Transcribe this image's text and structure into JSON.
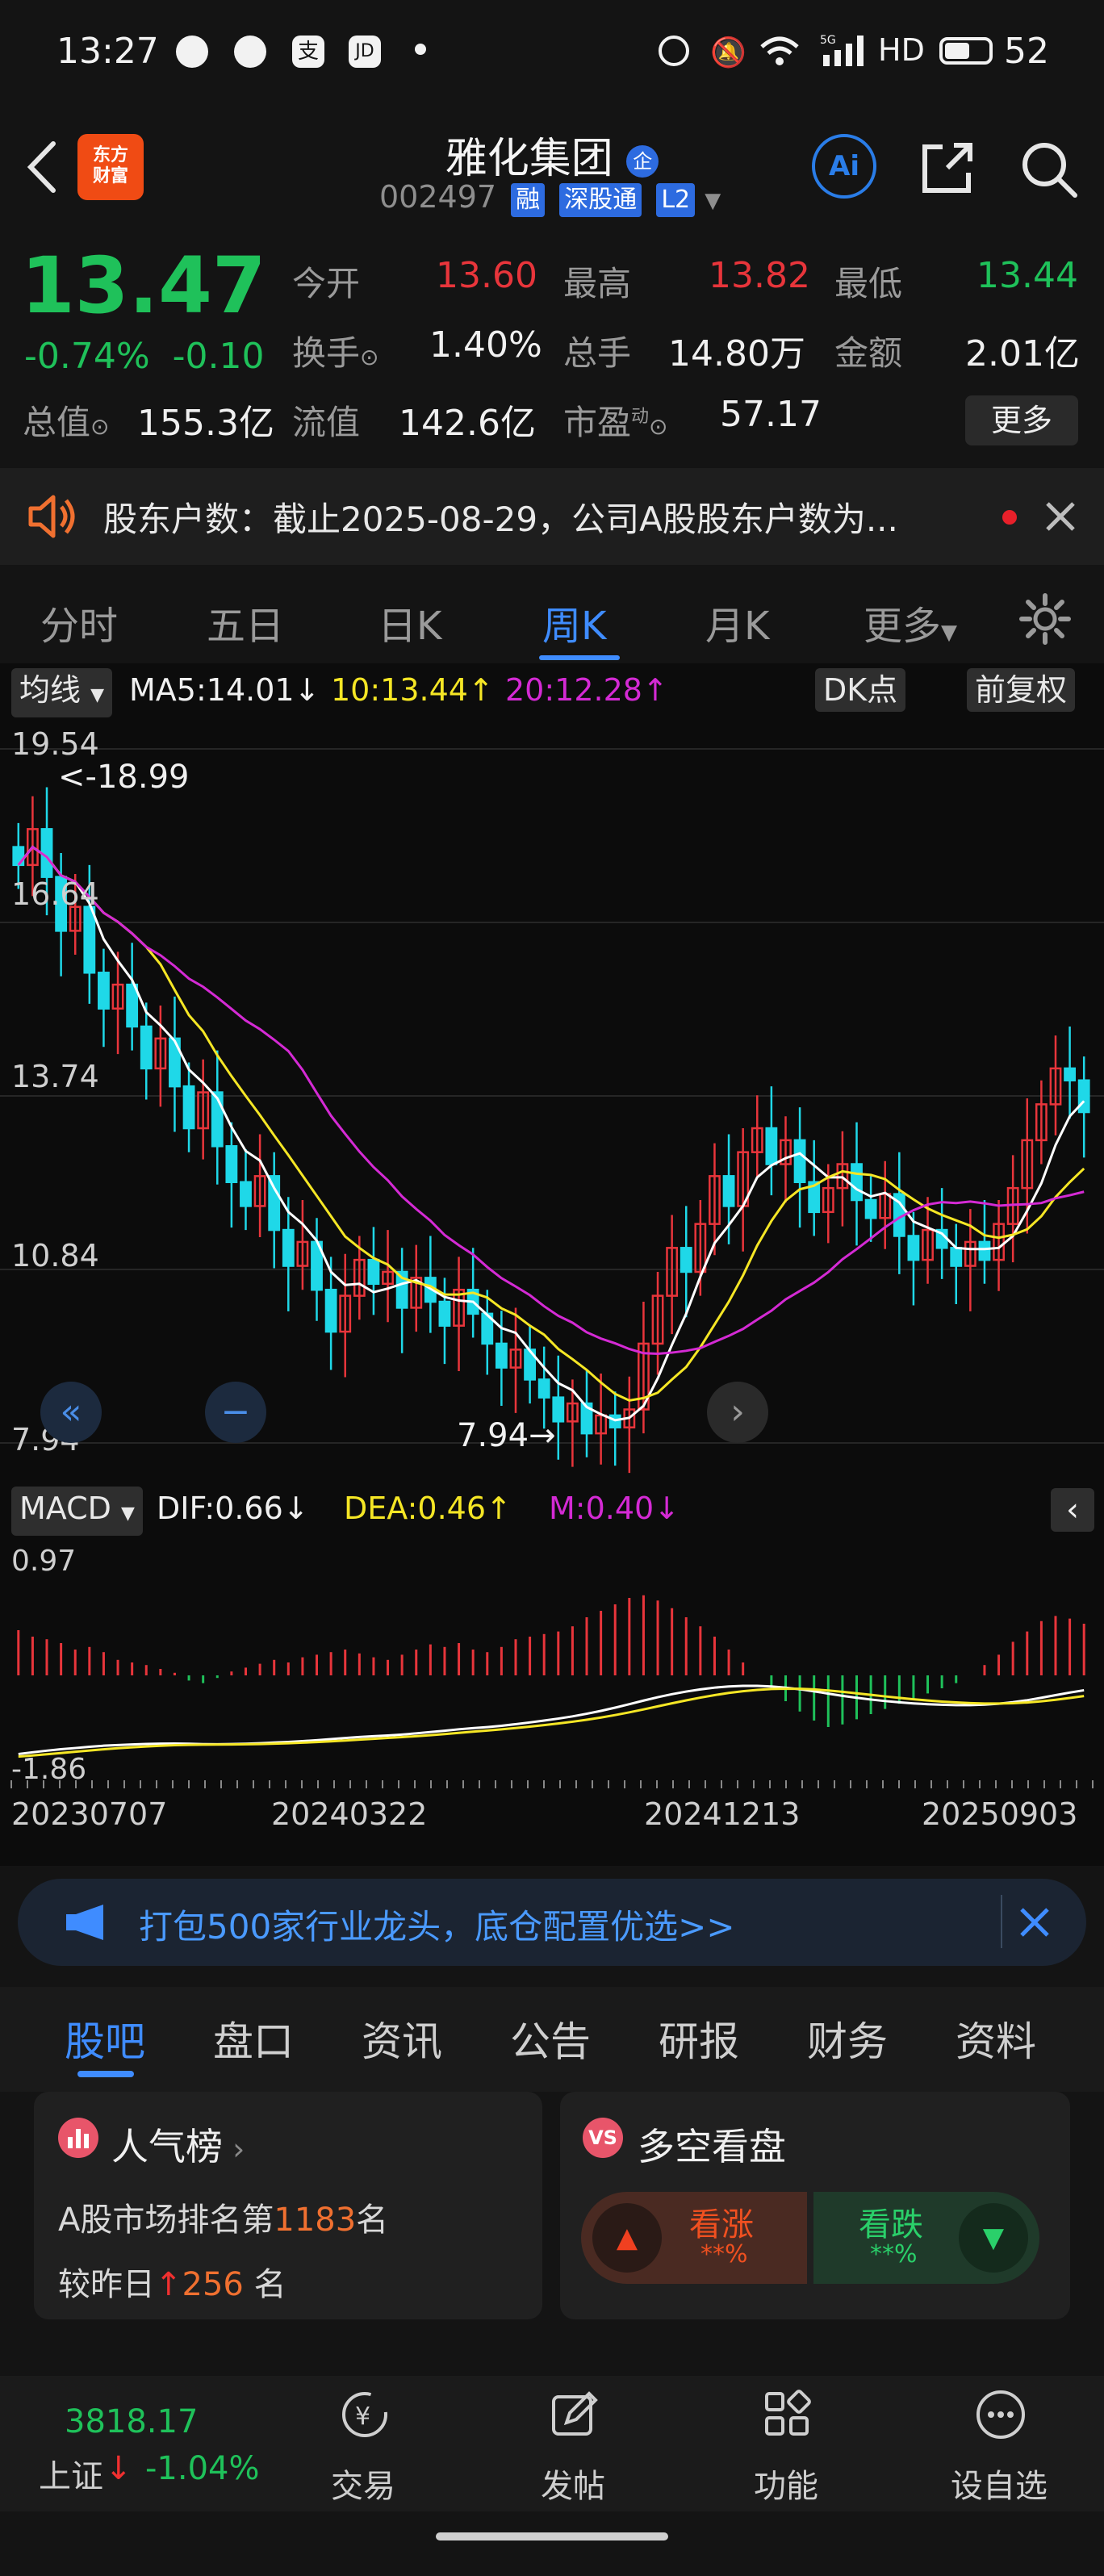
{
  "status_bar": {
    "time": "13:27",
    "network": "5G",
    "hd": "HD",
    "battery": "52"
  },
  "header": {
    "logo_line1": "东方",
    "logo_line2": "财富",
    "name": "雅化集团",
    "name_badge": "企",
    "code": "002497",
    "tags": [
      "融",
      "深股通",
      "L2"
    ],
    "ai_label": "Ai"
  },
  "quote": {
    "price": "13.47",
    "change_pct": "-0.74%",
    "change_abs": "-0.10",
    "open_label": "今开",
    "open": "13.60",
    "high_label": "最高",
    "high": "13.82",
    "low_label": "最低",
    "low": "13.44",
    "turnover_label": "换手",
    "turnover": "1.40%",
    "volume_label": "总手",
    "volume": "14.80万",
    "amount_label": "金额",
    "amount": "2.01亿",
    "mktcap_label": "总值",
    "mktcap": "155.3亿",
    "float_label": "流值",
    "float_cap": "142.6亿",
    "pe_label": "市盈",
    "pe_sup": "动",
    "pe": "57.17",
    "more": "更多"
  },
  "notice": {
    "text": "股东户数：截止2025-08-29，公司A股股东户数为..."
  },
  "ktabs": [
    "分时",
    "五日",
    "日K",
    "周K",
    "月K",
    "更多"
  ],
  "ktab_active": "周K",
  "ma_bar": {
    "selector": "均线",
    "ma5": "MA5:14.01↓",
    "ma10": "10:13.44↑",
    "ma20": "20:12.28↑",
    "dk": "DK点",
    "adjust": "前复权"
  },
  "chart_data": {
    "type": "candlestick",
    "title": "",
    "y_ticks": [
      "19.54",
      "16.64",
      "13.74",
      "10.84",
      "7.94"
    ],
    "ylim": [
      7.94,
      19.54
    ],
    "x_ticks": [
      "20230707",
      "20240322",
      "20241213",
      "20250903"
    ],
    "annotations": {
      "max_label": "<-18.99",
      "min_label": "7.94→"
    },
    "series": [
      {
        "name": "MA5",
        "color": "#ffffff"
      },
      {
        "name": "10",
        "color": "#f5e625"
      },
      {
        "name": "20",
        "color": "#d42ad4"
      }
    ],
    "close": [
      17.6,
      18.2,
      17.4,
      16.5,
      16.9,
      15.8,
      15.2,
      15.6,
      14.9,
      14.2,
      14.7,
      13.9,
      13.2,
      13.8,
      12.9,
      12.3,
      11.9,
      12.4,
      11.5,
      10.9,
      11.3,
      10.5,
      9.8,
      10.4,
      11.0,
      10.6,
      10.8,
      10.2,
      10.7,
      10.3,
      9.9,
      10.5,
      10.1,
      9.6,
      9.2,
      9.5,
      9.0,
      8.7,
      8.3,
      8.6,
      8.1,
      8.4,
      8.2,
      8.5,
      9.6,
      10.4,
      11.2,
      10.8,
      11.6,
      12.4,
      11.9,
      12.8,
      13.2,
      12.6,
      13.0,
      12.3,
      11.8,
      12.2,
      12.6,
      12.0,
      11.7,
      12.1,
      11.4,
      11.0,
      11.5,
      11.2,
      10.9,
      11.3,
      11.0,
      11.6,
      12.2,
      13.0,
      13.6,
      14.2,
      14.0,
      13.47
    ]
  },
  "macd": {
    "selector": "MACD",
    "dif": "DIF:0.66↓",
    "dea": "DEA:0.46↑",
    "m": "M:0.40↓",
    "y_top": "0.97",
    "y_bottom": "-1.86",
    "hist": [
      0.35,
      0.3,
      0.28,
      0.25,
      0.2,
      0.22,
      0.18,
      0.12,
      0.1,
      0.08,
      0.05,
      0.02,
      -0.04,
      -0.06,
      -0.02,
      0.03,
      0.06,
      0.09,
      0.12,
      0.1,
      0.14,
      0.16,
      0.18,
      0.2,
      0.17,
      0.14,
      0.12,
      0.16,
      0.2,
      0.24,
      0.22,
      0.25,
      0.2,
      0.18,
      0.22,
      0.28,
      0.3,
      0.32,
      0.34,
      0.38,
      0.45,
      0.5,
      0.55,
      0.6,
      0.62,
      0.58,
      0.52,
      0.45,
      0.38,
      0.3,
      0.2,
      0.1,
      0.0,
      -0.1,
      -0.2,
      -0.28,
      -0.35,
      -0.4,
      -0.38,
      -0.34,
      -0.3,
      -0.26,
      -0.22,
      -0.18,
      -0.14,
      -0.1,
      -0.06,
      0.0,
      0.08,
      0.16,
      0.26,
      0.34,
      0.42,
      0.46,
      0.44,
      0.4
    ]
  },
  "banner": {
    "text": "打包500家行业龙头，底仓配置优选>>"
  },
  "subtabs": [
    "股吧",
    "盘口",
    "资讯",
    "公告",
    "研报",
    "财务",
    "资料"
  ],
  "subtab_active": "股吧",
  "popularity": {
    "title": "人气榜",
    "rank_prefix": "A股市场排名第",
    "rank": "1183",
    "rank_suffix": "名",
    "vs_prefix": "较昨日",
    "vs_value": "256",
    "vs_suffix": "名"
  },
  "sentiment": {
    "title": "多空看盘",
    "up_label": "看涨",
    "up_value": "**%",
    "down_label": "看跌",
    "down_value": "**%"
  },
  "bottom_nav": {
    "index_value": "3818.17",
    "index_name": "上证",
    "index_change": "-1.04%",
    "items": [
      "交易",
      "发帖",
      "功能",
      "设自选"
    ]
  }
}
